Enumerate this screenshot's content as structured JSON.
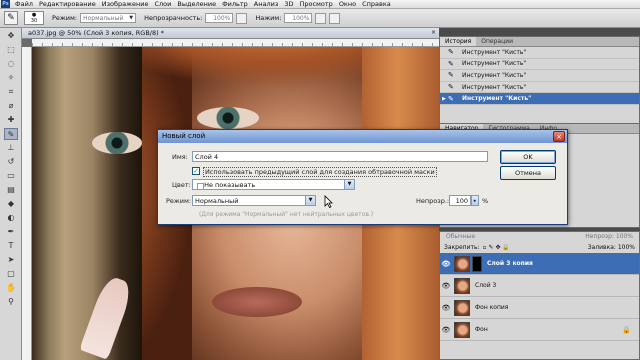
{
  "menu": {
    "items": [
      "Файл",
      "Редактирование",
      "Изображение",
      "Слои",
      "Выделение",
      "Фильтр",
      "Анализ",
      "3D",
      "Просмотр",
      "Окно",
      "Справка"
    ]
  },
  "options": {
    "brush_size": "30",
    "mode_label": "Режим:",
    "mode_value": "Нормальный",
    "opacity_label": "Непрозрачность:",
    "opacity_value": "100%",
    "pressure_label": "Нажим:",
    "pressure_value": "100%"
  },
  "document": {
    "tab_title": "a037.jpg @ 50% (Слой 3 копия, RGB/8) *",
    "close_glyph": "×"
  },
  "history": {
    "tabs": [
      "История",
      "Операции"
    ],
    "rows": [
      "Инструмент \"Кисть\"",
      "Инструмент \"Кисть\"",
      "Инструмент \"Кисть\"",
      "Инструмент \"Кисть\"",
      "Инструмент \"Кисть\""
    ],
    "selected_index": 4
  },
  "navigator": {
    "tabs": [
      "Навигатор",
      "Гистограмма",
      "Инфо"
    ]
  },
  "layers": {
    "blend_mode": "Обычные",
    "opacity_label": "Непрозр:",
    "opacity_value": "100%",
    "lock_label": "Закрепить:",
    "fill_label": "Заливка:",
    "fill_value": "100%",
    "rows": [
      {
        "name": "Слой 3 копия",
        "selected": true,
        "mask": true,
        "locked": false
      },
      {
        "name": "Слой 3",
        "selected": false,
        "mask": false,
        "locked": false
      },
      {
        "name": "Фон копия",
        "selected": false,
        "mask": false,
        "locked": false
      },
      {
        "name": "Фон",
        "selected": false,
        "mask": false,
        "locked": true
      }
    ]
  },
  "dialog": {
    "title": "Новый слой",
    "close_glyph": "×",
    "name_label": "Имя:",
    "name_value": "Слой 4",
    "clip_checkbox_label": "Использовать предыдущий слой для создания обтравочной маски",
    "clip_checked": true,
    "color_label": "Цвет:",
    "color_value": "Не показывать",
    "mode_label": "Режим:",
    "mode_value": "Нормальный",
    "opacity_label": "Непрозр.:",
    "opacity_value": "100",
    "opacity_unit": "%",
    "neutral_hint": "(Для режима \"Нормальный\" нет нейтральных цветов.)",
    "ok_label": "OK",
    "cancel_label": "Отмена"
  }
}
